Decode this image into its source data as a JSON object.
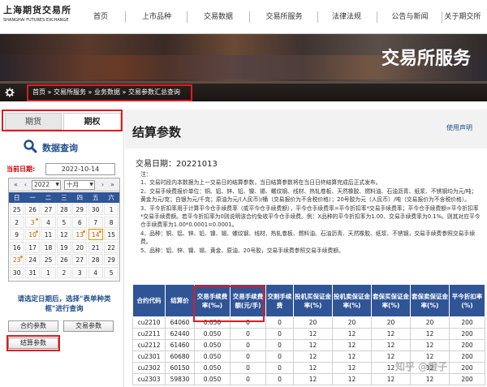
{
  "header": {
    "logo_cn": "上海期货交易所",
    "logo_en": "SHANGHAI FUTURES EXCHANGE",
    "nav": [
      "首页",
      "上市品种",
      "交易数据",
      "交易所服务",
      "法律法规",
      "公告与新闻",
      "关于期交所"
    ]
  },
  "banner": {
    "title": "交易所服务"
  },
  "breadcrumb": {
    "items": [
      "首页",
      "交易所服务",
      "业务数据",
      "交易参数汇总查询"
    ],
    "separator": "»"
  },
  "sidebar": {
    "tabs": [
      "期货",
      "期权"
    ],
    "active_tab": "期权",
    "query_title": "数据查询",
    "date_label": "当前日期:",
    "date_value": "2022-10-14",
    "calendar": {
      "year": "2022",
      "month": "十月",
      "weekdays": [
        "日",
        "一",
        "二",
        "三",
        "四",
        "五",
        "六"
      ],
      "days": [
        [
          "25",
          "26",
          "27",
          "28",
          "29",
          "30",
          "1"
        ],
        [
          "2",
          "3",
          "4",
          "5",
          "6",
          "7",
          "8"
        ],
        [
          "9",
          "10",
          "11",
          "12",
          "13",
          "14",
          "15"
        ],
        [
          "16",
          "17",
          "18",
          "19",
          "20",
          "21",
          "22"
        ],
        [
          "23",
          "24",
          "25",
          "26",
          "27",
          "28",
          "29"
        ],
        [
          "30",
          "31",
          "1",
          "2",
          "3",
          "4",
          "5"
        ]
      ]
    },
    "hint": "请选定日期后，选择\"表单种类框\"进行查询",
    "buttons": {
      "contract": "合约参数",
      "trade": "交易参数",
      "settle": "结算参数"
    }
  },
  "content": {
    "title": "结算参数",
    "disclaimer": "使用声明",
    "trade_date": "交易日期：20221013",
    "notes_title": "注：",
    "notes": [
      "1、交易时段内本数据为上一交易日的结算参数，当日结算参数将在当日日终结算完成后正式发布。",
      "2、交易手续费报价单位：铜、铝、锌、铅、镍、锡、螺纹钢、线材、热轧卷板、天然橡胶、燃料油、石油沥青、纸浆、不锈钢均为元/吨；黄金为元/克；白银为元/千克；原油为元/(人民币)/桶（交易报价为不含税价格）；20号胶为元（人民币）/吨（交易报价为不含税价格）。",
      "3、平今折扣率用于计算平今仓手续费率（或平今仓手续费额），平今仓手续费率=平今折扣率*交易手续费率；平今仓手续费额=平今折扣率*交易手续费额。若平今折扣率为0则说明该合约免收平今仓手续费。例：X品种的平今折扣率为1.00、交易手续费率为0.1%。则其对应平今仓手续费率为1.00*0.0001=0.0001。",
      "4、品种：铜、铝、锌、铅、镍、锡、螺纹钢、线材、热轧卷板、燃料油、石油沥青、天然橡胶、纸浆、不锈钢，交易手续费参照交易手续费。",
      "5、品种：铝、锌、镍、锡、黄金、原油、20号胶，交易手续费参照交易手续费额。"
    ],
    "table": {
      "headers": [
        "合约代码",
        "结算价",
        "交易手续费率(‰)",
        "交易手续费额(元/手)",
        "交割手续费",
        "投机买保证金率(%)",
        "投机卖保证金率(%)",
        "套保买保证金率(%)",
        "套保卖保证金率(%)",
        "平今折扣率(%)"
      ],
      "rows": [
        [
          "cu2210",
          "64060",
          "0.050",
          "0",
          "0",
          "20",
          "20",
          "20",
          "20",
          "200"
        ],
        [
          "cu2211",
          "62440",
          "0.050",
          "0",
          "0",
          "12",
          "12",
          "12",
          "12",
          "200"
        ],
        [
          "cu2212",
          "61460",
          "0.050",
          "0",
          "0",
          "12",
          "12",
          "12",
          "12",
          "200"
        ],
        [
          "cu2301",
          "60680",
          "0.050",
          "0",
          "0",
          "12",
          "12",
          "12",
          "12",
          "200"
        ],
        [
          "cu2302",
          "60150",
          "0.050",
          "0",
          "0",
          "12",
          "12",
          "12",
          "12",
          "200"
        ],
        [
          "cu2303",
          "59830",
          "0.050",
          "0",
          "0",
          "12",
          "12",
          "12",
          "12",
          "200"
        ]
      ]
    }
  },
  "watermark": "知乎 @橙子",
  "colors": {
    "accent_red": "#e01b22",
    "table_header": "#2f5597",
    "link_blue": "#1f4e8c"
  }
}
